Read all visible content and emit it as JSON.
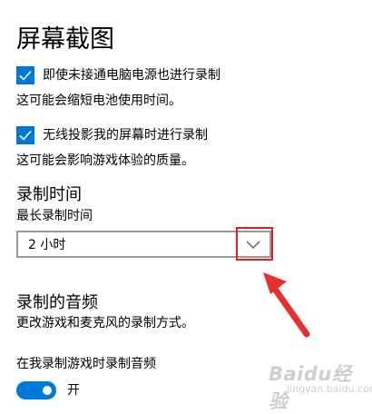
{
  "page_title": "屏幕截图",
  "record_on_battery": {
    "label": "即使未接通电脑电源也进行录制",
    "checked": true,
    "description": "这可能会缩短电池使用时间。"
  },
  "record_wireless": {
    "label": "无线投影我的屏幕时进行录制",
    "checked": true,
    "description": "这可能会影响游戏体验的质量。"
  },
  "record_length": {
    "heading": "录制时间",
    "field_label": "最长录制时间",
    "selected": "2 小时"
  },
  "audio": {
    "heading": "录制的音频",
    "description": "更改游戏和麦克风的录制方式。",
    "toggle_label": "在我录制游戏时录制音频",
    "toggle_state": "开",
    "toggle_on": true
  },
  "watermark": {
    "brand": "Baidu经验",
    "url": "jingyan.baidu.com"
  },
  "colors": {
    "accent": "#0078d7",
    "annotation_red": "#e02020"
  }
}
